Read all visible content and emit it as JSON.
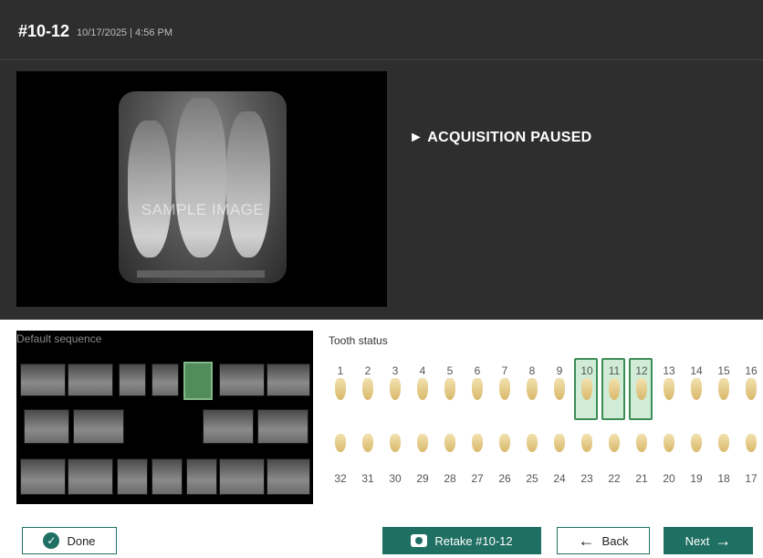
{
  "header": {
    "title": "#10-12",
    "timestamp": "10/17/2025 | 4:56 PM"
  },
  "viewer": {
    "watermark": "SAMPLE IMAGE"
  },
  "status": {
    "text": "► ACQUISITION PAUSED"
  },
  "sequence": {
    "label": "Default sequence"
  },
  "tooth_status": {
    "label": "Tooth status",
    "upper": [
      "1",
      "2",
      "3",
      "4",
      "5",
      "6",
      "7",
      "8",
      "9",
      "10",
      "11",
      "12",
      "13",
      "14",
      "15",
      "16"
    ],
    "lower": [
      "32",
      "31",
      "30",
      "29",
      "28",
      "27",
      "26",
      "25",
      "24",
      "23",
      "22",
      "21",
      "20",
      "19",
      "18",
      "17"
    ],
    "selected": [
      "10",
      "11",
      "12"
    ]
  },
  "buttons": {
    "done": "Done",
    "retake": "Retake #10-12",
    "back": "Back",
    "next": "Next"
  },
  "colors": {
    "accent": "#1f6f62",
    "panel": "#2e2e2e",
    "selected": "#3c8d55"
  }
}
